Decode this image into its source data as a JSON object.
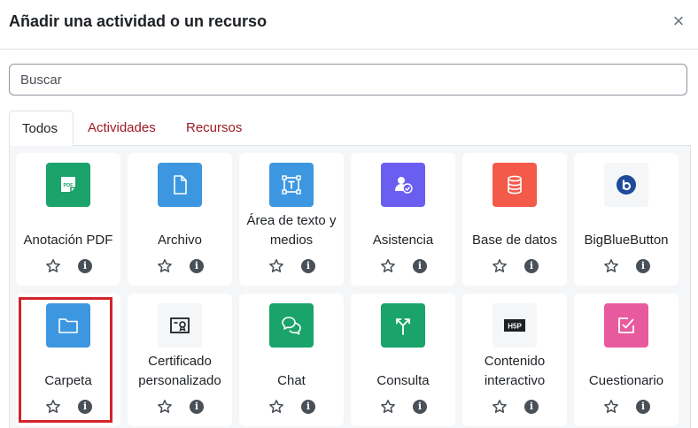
{
  "dialog": {
    "title": "Añadir una actividad o un recurso",
    "close_symbol": "×"
  },
  "search": {
    "placeholder": "Buscar",
    "value": ""
  },
  "tabs": [
    {
      "label": "Todos",
      "active": true
    },
    {
      "label": "Actividades",
      "active": false
    },
    {
      "label": "Recursos",
      "active": false
    }
  ],
  "modules": [
    {
      "lines": [
        "Anotación PDF"
      ],
      "icon": "pdf-annotation-icon",
      "color": "#1aa36a",
      "selected": false
    },
    {
      "lines": [
        "Archivo"
      ],
      "icon": "file-icon",
      "color": "#3d97e0",
      "selected": false
    },
    {
      "lines": [
        "Área de texto y",
        "medios"
      ],
      "icon": "text-media-icon",
      "color": "#3d97e0",
      "selected": false
    },
    {
      "lines": [
        "Asistencia"
      ],
      "icon": "attendance-icon",
      "color": "#6a5ef0",
      "selected": false
    },
    {
      "lines": [
        "Base de datos"
      ],
      "icon": "database-icon",
      "color": "#f35a4a",
      "selected": false
    },
    {
      "lines": [
        "BigBlueButton"
      ],
      "icon": "bigbluebutton-icon",
      "color": "#f5f6f8",
      "selected": false
    },
    {
      "lines": [
        "Carpeta"
      ],
      "icon": "folder-icon",
      "color": "#3d97e0",
      "selected": true
    },
    {
      "lines": [
        "Certificado",
        "personalizado"
      ],
      "icon": "certificate-icon",
      "color": "#f5f6f8",
      "selected": false
    },
    {
      "lines": [
        "Chat"
      ],
      "icon": "chat-icon",
      "color": "#1aa36a",
      "selected": false
    },
    {
      "lines": [
        "Consulta"
      ],
      "icon": "choice-icon",
      "color": "#1aa36a",
      "selected": false
    },
    {
      "lines": [
        "Contenido",
        "interactivo"
      ],
      "icon": "h5p-icon",
      "color": "#f5f6f8",
      "selected": false
    },
    {
      "lines": [
        "Cuestionario"
      ],
      "icon": "quiz-icon",
      "color": "#e85a9e",
      "selected": false
    }
  ],
  "actions": {
    "star_icon": "star-outline-icon",
    "info_icon": "info-icon",
    "info_symbol": "i"
  },
  "colors": {
    "link": "#a01a26",
    "highlight": "#d2232a"
  }
}
